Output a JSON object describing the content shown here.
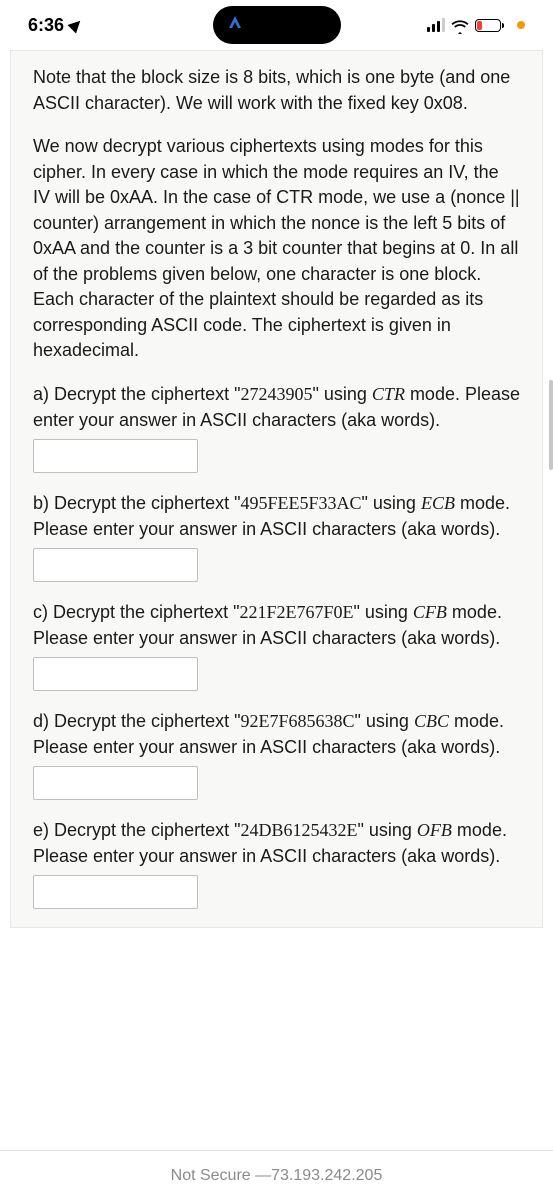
{
  "statusBar": {
    "time": "6:36"
  },
  "intro": {
    "p1": "Note that the block size is 8 bits, which is one byte (and one ASCII character). We will work with the fixed key 0x08.",
    "p2": "We now decrypt various ciphertexts using modes for this cipher. In every case in which the mode requires an IV, the IV will be 0xAA. In the case of CTR mode, we use a (nonce || counter) arrangement in which the nonce is the left 5 bits of 0xAA and the counter is a 3 bit counter that begins at 0. In all of the problems given below, one character is one block. Each character of the plaintext should be regarded as its corresponding ASCII code. The ciphertext is given in hexadecimal."
  },
  "questions": {
    "a": {
      "pre": "a) Decrypt the ciphertext \"",
      "code": "27243905",
      "mid": "\" using ",
      "mode": "CTR",
      "post": " mode. Please enter your answer in ASCII characters (aka words)."
    },
    "b": {
      "pre": "b) Decrypt the ciphertext \"",
      "code": "495FEE5F33AC",
      "mid": "\" using ",
      "mode": "ECB",
      "post": " mode. Please enter your answer in ASCII characters (aka words)."
    },
    "c": {
      "pre": "c) Decrypt the ciphertext \"",
      "code": "221F2E767F0E",
      "mid": "\" using ",
      "mode": "CFB",
      "post": " mode. Please enter your answer in ASCII characters (aka words)."
    },
    "d": {
      "pre": "d) Decrypt the ciphertext \"",
      "code": "92E7F685638C",
      "mid": "\" using ",
      "mode": "CBC",
      "post": " mode. Please enter your answer in ASCII characters (aka words)."
    },
    "e": {
      "pre": "e) Decrypt the ciphertext \"",
      "code": "24DB6125432E",
      "mid": "\" using ",
      "mode": "OFB",
      "post": " mode. Please enter your answer in ASCII characters (aka words)."
    }
  },
  "bottomBar": {
    "prefix": "Not Secure — ",
    "host": "73.193.242.205"
  }
}
